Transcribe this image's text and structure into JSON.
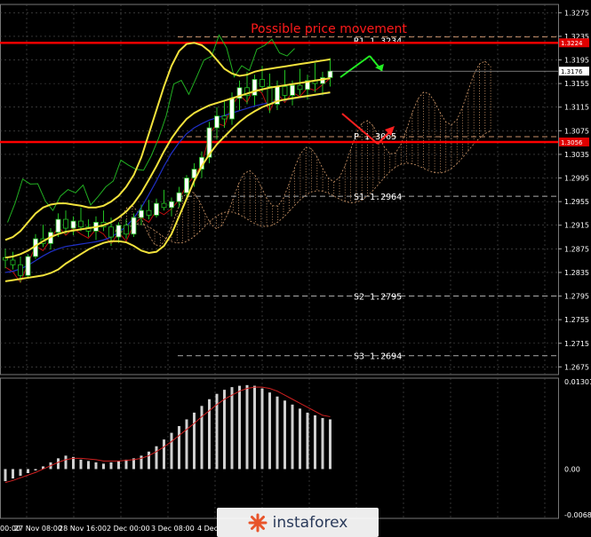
{
  "chart_data": {
    "type": "candlestick",
    "title": "Possible price movement",
    "price_axis": {
      "ylim": [
        1.2662,
        1.3289
      ],
      "ticks": [
        "1.3275",
        "1.3235",
        "1.3195",
        "1.3155",
        "1.3115",
        "1.3075",
        "1.3035",
        "1.2995",
        "1.2955",
        "1.2915",
        "1.2875",
        "1.2835",
        "1.2795",
        "1.2755",
        "1.2715",
        "1.2675"
      ],
      "current_price_tag": "1.3176",
      "r1_tag": "1.3224",
      "p_tag": "1.3056"
    },
    "time_labels": [
      "00:00",
      "27 Nov 08:00",
      "28 Nov 16:00",
      "2 Dec 00:00",
      "3 Dec 08:00",
      "4 Dec"
    ],
    "levels": [
      {
        "name": "R1",
        "value": 1.3234,
        "label": "R1 1.3234",
        "style": "dashed",
        "color": "#c8906a"
      },
      {
        "name": "P",
        "value": 1.3065,
        "label": "P 1.3065",
        "style": "dashed",
        "color": "#c8906a"
      },
      {
        "name": "S1",
        "value": 1.2964,
        "label": "S1 1.2964",
        "style": "dashed",
        "color": "#aaaaaa"
      },
      {
        "name": "S2",
        "value": 1.2795,
        "label": "S2 1.2795",
        "style": "dashed",
        "color": "#aaaaaa"
      },
      {
        "name": "S3",
        "value": 1.2694,
        "label": "S3 1.2694",
        "style": "dashed",
        "color": "#aaaaaa"
      }
    ],
    "red_lines": [
      1.3224,
      1.3056
    ],
    "candles": [
      [
        1.286,
        1.2875,
        1.2842,
        1.2856
      ],
      [
        1.2856,
        1.287,
        1.284,
        1.2848
      ],
      [
        1.2848,
        1.2862,
        1.2818,
        1.283
      ],
      [
        1.283,
        1.2866,
        1.2826,
        1.2862
      ],
      [
        1.2862,
        1.29,
        1.2858,
        1.2892
      ],
      [
        1.2892,
        1.2916,
        1.2878,
        1.2884
      ],
      [
        1.2884,
        1.291,
        1.2874,
        1.2903
      ],
      [
        1.2903,
        1.2935,
        1.2895,
        1.2925
      ],
      [
        1.2925,
        1.294,
        1.29,
        1.291
      ],
      [
        1.291,
        1.293,
        1.2898,
        1.2922
      ],
      [
        1.2922,
        1.2945,
        1.2905,
        1.2912
      ],
      [
        1.2912,
        1.2925,
        1.2895,
        1.2905
      ],
      [
        1.2905,
        1.293,
        1.289,
        1.292
      ],
      [
        1.292,
        1.294,
        1.2905,
        1.2912
      ],
      [
        1.2912,
        1.2928,
        1.288,
        1.2895
      ],
      [
        1.2895,
        1.292,
        1.2885,
        1.2915
      ],
      [
        1.2915,
        1.2925,
        1.2892,
        1.29
      ],
      [
        1.29,
        1.2935,
        1.2895,
        1.2928
      ],
      [
        1.2928,
        1.295,
        1.2915,
        1.294
      ],
      [
        1.294,
        1.2958,
        1.2925,
        1.2932
      ],
      [
        1.2932,
        1.296,
        1.2928,
        1.2952
      ],
      [
        1.2952,
        1.2975,
        1.294,
        1.2945
      ],
      [
        1.2945,
        1.2962,
        1.293,
        1.2955
      ],
      [
        1.2955,
        1.298,
        1.2945,
        1.297
      ],
      [
        1.297,
        1.3,
        1.296,
        1.2995
      ],
      [
        1.2995,
        1.302,
        1.298,
        1.301
      ],
      [
        1.301,
        1.304,
        1.2995,
        1.303
      ],
      [
        1.303,
        1.309,
        1.302,
        1.308
      ],
      [
        1.308,
        1.3115,
        1.306,
        1.31
      ],
      [
        1.31,
        1.3125,
        1.308,
        1.3095
      ],
      [
        1.3095,
        1.314,
        1.3085,
        1.313
      ],
      [
        1.313,
        1.316,
        1.311,
        1.3148
      ],
      [
        1.3148,
        1.3175,
        1.312,
        1.3135
      ],
      [
        1.3135,
        1.317,
        1.3118,
        1.3162
      ],
      [
        1.3162,
        1.3185,
        1.314,
        1.315
      ],
      [
        1.315,
        1.3172,
        1.3105,
        1.312
      ],
      [
        1.312,
        1.316,
        1.311,
        1.315
      ],
      [
        1.315,
        1.3178,
        1.3125,
        1.3135
      ],
      [
        1.3135,
        1.316,
        1.3118,
        1.3152
      ],
      [
        1.3152,
        1.318,
        1.3135,
        1.3145
      ],
      [
        1.3145,
        1.317,
        1.3128,
        1.316
      ],
      [
        1.316,
        1.319,
        1.314,
        1.3155
      ],
      [
        1.3155,
        1.3175,
        1.3135,
        1.3165
      ],
      [
        1.3165,
        1.3198,
        1.315,
        1.3176
      ]
    ],
    "bollinger": {
      "upper": [
        1.289,
        1.2895,
        1.2905,
        1.292,
        1.2935,
        1.2945,
        1.295,
        1.2952,
        1.2952,
        1.295,
        1.2948,
        1.2945,
        1.2945,
        1.2948,
        1.2955,
        1.2965,
        1.298,
        1.3,
        1.303,
        1.307,
        1.311,
        1.315,
        1.3185,
        1.321,
        1.3222,
        1.3224,
        1.322,
        1.321,
        1.3195,
        1.318,
        1.3172,
        1.3168,
        1.317,
        1.3175,
        1.3178,
        1.318,
        1.3182,
        1.3184,
        1.3186,
        1.3188,
        1.319,
        1.3192,
        1.3194,
        1.3196
      ],
      "middle": [
        1.286,
        1.2862,
        1.2866,
        1.2872,
        1.288,
        1.2888,
        1.2895,
        1.29,
        1.2904,
        1.2906,
        1.2908,
        1.291,
        1.2912,
        1.2915,
        1.292,
        1.2928,
        1.2938,
        1.2952,
        1.297,
        1.2992,
        1.3015,
        1.304,
        1.3062,
        1.308,
        1.3095,
        1.3105,
        1.3112,
        1.3118,
        1.3122,
        1.3126,
        1.313,
        1.3134,
        1.3138,
        1.3142,
        1.3145,
        1.3148,
        1.315,
        1.3152,
        1.3154,
        1.3156,
        1.3158,
        1.316,
        1.3162,
        1.3164
      ],
      "lower": [
        1.282,
        1.2822,
        1.2824,
        1.2826,
        1.2828,
        1.283,
        1.2834,
        1.284,
        1.285,
        1.2858,
        1.2866,
        1.2874,
        1.288,
        1.2885,
        1.2888,
        1.2888,
        1.2886,
        1.288,
        1.2872,
        1.2868,
        1.287,
        1.288,
        1.29,
        1.293,
        1.296,
        1.299,
        1.3015,
        1.3035,
        1.3052,
        1.3065,
        1.3078,
        1.309,
        1.31,
        1.3108,
        1.3115,
        1.312,
        1.3125,
        1.3128,
        1.313,
        1.3132,
        1.3134,
        1.3136,
        1.3138,
        1.314
      ]
    },
    "macd": {
      "ylim": [
        -0.00681,
        0.01301
      ],
      "ticks": [
        "0.01301",
        "0.00",
        "-0.00681"
      ],
      "histogram": [
        -0.0018,
        -0.0014,
        -0.001,
        -0.0006,
        -0.0002,
        0.0004,
        0.001,
        0.0016,
        0.002,
        0.0018,
        0.0014,
        0.0012,
        0.001,
        0.0008,
        0.001,
        0.0012,
        0.0014,
        0.0016,
        0.002,
        0.0026,
        0.0034,
        0.0044,
        0.0054,
        0.0064,
        0.0074,
        0.0084,
        0.0094,
        0.0104,
        0.0112,
        0.0118,
        0.0122,
        0.0124,
        0.0125,
        0.0124,
        0.012,
        0.0114,
        0.0108,
        0.0102,
        0.0096,
        0.009,
        0.0084,
        0.008,
        0.0076,
        0.0074
      ],
      "signal": [
        -0.002,
        -0.0017,
        -0.0013,
        -0.0009,
        -0.0005,
        0.0,
        0.0005,
        0.001,
        0.0014,
        0.0016,
        0.0016,
        0.0015,
        0.0014,
        0.0012,
        0.0012,
        0.0012,
        0.0013,
        0.0014,
        0.0016,
        0.002,
        0.0026,
        0.0033,
        0.0041,
        0.005,
        0.0059,
        0.0068,
        0.0078,
        0.0087,
        0.0096,
        0.0104,
        0.011,
        0.0116,
        0.012,
        0.0122,
        0.0122,
        0.012,
        0.0116,
        0.011,
        0.0104,
        0.0098,
        0.0092,
        0.0086,
        0.008,
        0.0078
      ]
    }
  },
  "watermark": {
    "text": "instaforex",
    "logo": "instaforex-logo"
  }
}
